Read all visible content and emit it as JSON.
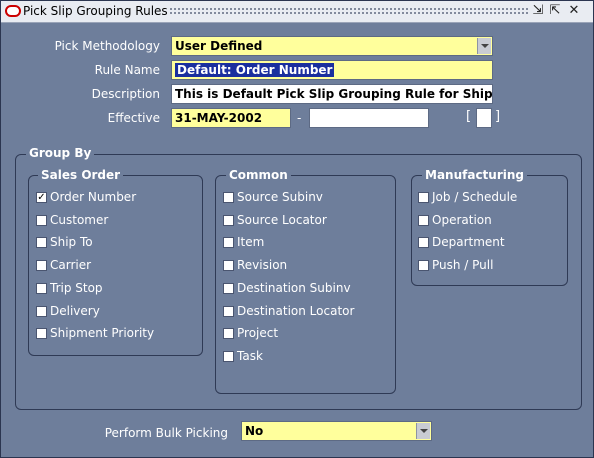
{
  "window": {
    "title": "Pick Slip Grouping Rules"
  },
  "form": {
    "pick_methodology": {
      "label": "Pick Methodology",
      "value": "User Defined"
    },
    "rule_name": {
      "label": "Rule Name",
      "value": "Default: Order Number"
    },
    "description": {
      "label": "Description",
      "value": "This is Default Pick Slip Grouping Rule for Shippin"
    },
    "effective": {
      "label": "Effective",
      "from": "31-MAY-2002",
      "separator": "-",
      "to": ""
    },
    "dff": {
      "open": "[",
      "close": "]"
    }
  },
  "group_by": {
    "title": "Group By",
    "sales_order": {
      "title": "Sales Order",
      "items": [
        {
          "label": "Order Number",
          "checked": true
        },
        {
          "label": "Customer",
          "checked": false
        },
        {
          "label": "Ship To",
          "checked": false
        },
        {
          "label": "Carrier",
          "checked": false
        },
        {
          "label": "Trip Stop",
          "checked": false
        },
        {
          "label": "Delivery",
          "checked": false
        },
        {
          "label": "Shipment Priority",
          "checked": false
        }
      ]
    },
    "common": {
      "title": "Common",
      "items": [
        {
          "label": "Source Subinv",
          "checked": false
        },
        {
          "label": "Source Locator",
          "checked": false
        },
        {
          "label": "Item",
          "checked": false
        },
        {
          "label": "Revision",
          "checked": false
        },
        {
          "label": "Destination Subinv",
          "checked": false
        },
        {
          "label": "Destination Locator",
          "checked": false
        },
        {
          "label": "Project",
          "checked": false
        },
        {
          "label": "Task",
          "checked": false
        }
      ]
    },
    "manufacturing": {
      "title": "Manufacturing",
      "items": [
        {
          "label": "Job / Schedule",
          "checked": false
        },
        {
          "label": "Operation",
          "checked": false
        },
        {
          "label": "Department",
          "checked": false
        },
        {
          "label": "Push / Pull",
          "checked": false
        }
      ]
    }
  },
  "bulk": {
    "label": "Perform Bulk Picking",
    "value": "No"
  }
}
